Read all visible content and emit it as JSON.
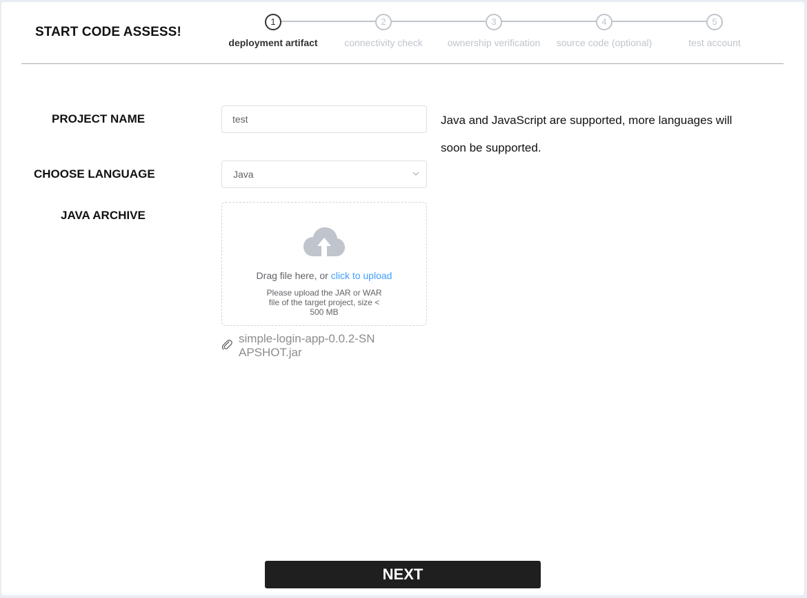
{
  "page": {
    "title": "START CODE ASSESS!"
  },
  "steps": [
    {
      "number": "1",
      "label": "deployment artifact",
      "active": true
    },
    {
      "number": "2",
      "label": "connectivity check",
      "active": false
    },
    {
      "number": "3",
      "label": "ownership verification",
      "active": false
    },
    {
      "number": "4",
      "label": "source code (optional)",
      "active": false
    },
    {
      "number": "5",
      "label": "test account",
      "active": false
    }
  ],
  "form": {
    "project_name_label": "PROJECT NAME",
    "project_name_value": "test",
    "language_label": "CHOOSE LANGUAGE",
    "language_value": "Java",
    "archive_label": "JAVA ARCHIVE",
    "language_hint": "Java and JavaScript are supported, more languages will soon be supported."
  },
  "upload": {
    "drag_text": "Drag file here, or ",
    "click_text": "click to upload",
    "tip": "Please upload the JAR or WAR file of the target project, size < 500 MB",
    "icon": "cloud-upload-icon"
  },
  "file": {
    "name": "simple-login-app-0.0.2-SNAPSHOT.jar",
    "icon": "paperclip-icon"
  },
  "actions": {
    "next_label": "NEXT"
  },
  "colors": {
    "accent": "#409eff",
    "active_step": "#303133",
    "inactive_step": "#c0c4cc",
    "button_bg": "#1f1f1f"
  }
}
